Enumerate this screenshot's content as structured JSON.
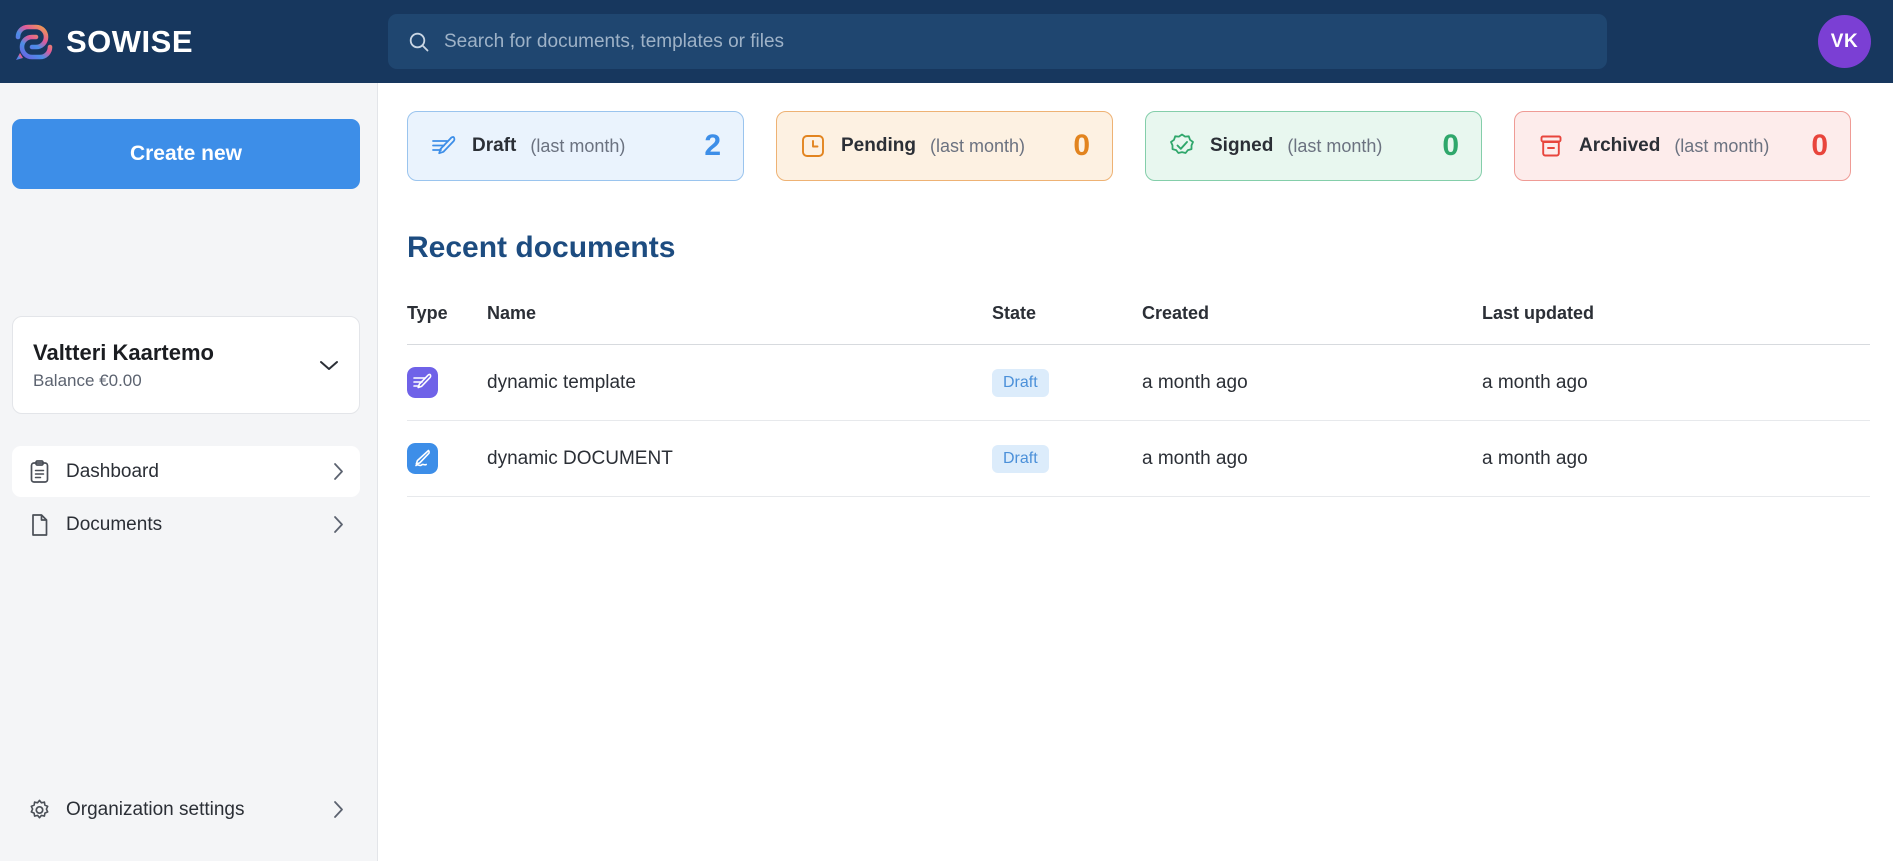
{
  "brand": {
    "name": "SOWISE",
    "logo_icon": "sowise-logo-icon"
  },
  "search": {
    "placeholder": "Search for documents, templates or files",
    "value": "",
    "icon": "search-icon"
  },
  "account": {
    "avatar_initials": "VK",
    "avatar_color": "#7b3fd4"
  },
  "sidebar": {
    "create_button": "Create new",
    "organization": {
      "name": "Valtteri Kaartemo",
      "balance": "Balance €0.00",
      "chevron_icon": "chevron-down-icon"
    },
    "items": [
      {
        "label": "Dashboard",
        "icon": "clipboard-icon",
        "active": true
      },
      {
        "label": "Documents",
        "icon": "file-icon",
        "active": false
      }
    ],
    "bottom_items": [
      {
        "label": "Organization settings",
        "icon": "gear-icon"
      }
    ]
  },
  "stats": [
    {
      "label": "Draft",
      "period": "(last month)",
      "value": "2",
      "icon": "draft-pen-icon",
      "color": "#3d8ee8"
    },
    {
      "label": "Pending",
      "period": "(last month)",
      "value": "0",
      "icon": "pending-clock-icon",
      "color": "#e2841f"
    },
    {
      "label": "Signed",
      "period": "(last month)",
      "value": "0",
      "icon": "signed-badge-icon",
      "color": "#2fa76b"
    },
    {
      "label": "Archived",
      "period": "(last month)",
      "value": "0",
      "icon": "archive-box-icon",
      "color": "#e8453c"
    }
  ],
  "main": {
    "section_title": "Recent documents",
    "table": {
      "columns": [
        "Type",
        "Name",
        "State",
        "Created",
        "Last updated"
      ],
      "rows": [
        {
          "type_icon": "template-pen-icon",
          "type_color": "#6f62e8",
          "name": "dynamic template",
          "state": "Draft",
          "created": "a month ago",
          "updated": "a month ago"
        },
        {
          "type_icon": "document-signature-icon",
          "type_color": "#3d8ee8",
          "name": "dynamic DOCUMENT",
          "state": "Draft",
          "created": "a month ago",
          "updated": "a month ago"
        }
      ]
    }
  }
}
